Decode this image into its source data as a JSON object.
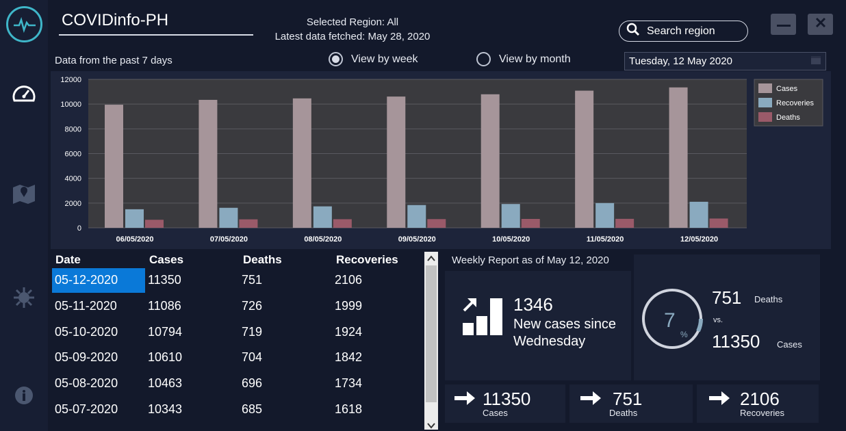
{
  "app": {
    "title": "COVIDinfo-PH"
  },
  "header": {
    "selected_region": "Selected Region: All",
    "latest_fetch": "Latest data fetched: May 28, 2020",
    "search_placeholder": "Search region"
  },
  "controls": {
    "subtitle": "Data from the past 7 days",
    "view_week": "View by week",
    "view_month": "View by month",
    "selected_view": "week",
    "date_value": "Tuesday, 12 May 2020"
  },
  "chart_data": {
    "type": "bar",
    "categories": [
      "06/05/2020",
      "07/05/2020",
      "08/05/2020",
      "09/05/2020",
      "10/05/2020",
      "11/05/2020",
      "12/05/2020"
    ],
    "series": [
      {
        "name": "Cases",
        "color": "#a6959a",
        "values": [
          9950,
          10343,
          10463,
          10610,
          10794,
          11086,
          11350
        ]
      },
      {
        "name": "Recoveries",
        "color": "#8aaabf",
        "values": [
          1500,
          1618,
          1734,
          1842,
          1924,
          1999,
          2106
        ]
      },
      {
        "name": "Deaths",
        "color": "#9a5a69",
        "values": [
          650,
          685,
          696,
          704,
          719,
          726,
          751
        ]
      }
    ],
    "yticks": [
      "12000",
      "10000",
      "8000",
      "6000",
      "4000",
      "2000",
      "0"
    ],
    "ylim": [
      0,
      12000
    ],
    "grid": true,
    "legend": "top-right"
  },
  "table": {
    "columns": [
      "Date",
      "Cases",
      "Deaths",
      "Recoveries"
    ],
    "rows": [
      [
        "05-12-2020",
        "11350",
        "751",
        "2106"
      ],
      [
        "05-11-2020",
        "11086",
        "726",
        "1999"
      ],
      [
        "05-10-2020",
        "10794",
        "719",
        "1924"
      ],
      [
        "05-09-2020",
        "10610",
        "704",
        "1842"
      ],
      [
        "05-08-2020",
        "10463",
        "696",
        "1734"
      ],
      [
        "05-07-2020",
        "10343",
        "685",
        "1618"
      ]
    ]
  },
  "report": {
    "title": "Weekly Report as of May 12, 2020",
    "new_cases": "1346",
    "new_cases_line1": "New cases since",
    "new_cases_line2": "Wednesday",
    "ratio_value": "7",
    "ratio_unit": "%",
    "deaths_num": "751",
    "deaths_label": "Deaths",
    "vs": "vs.",
    "cases_num": "11350",
    "cases_label": "Cases",
    "summary": [
      {
        "value": "11350",
        "label": "Cases"
      },
      {
        "value": "751",
        "label": "Deaths"
      },
      {
        "value": "2106",
        "label": "Recoveries"
      }
    ]
  }
}
